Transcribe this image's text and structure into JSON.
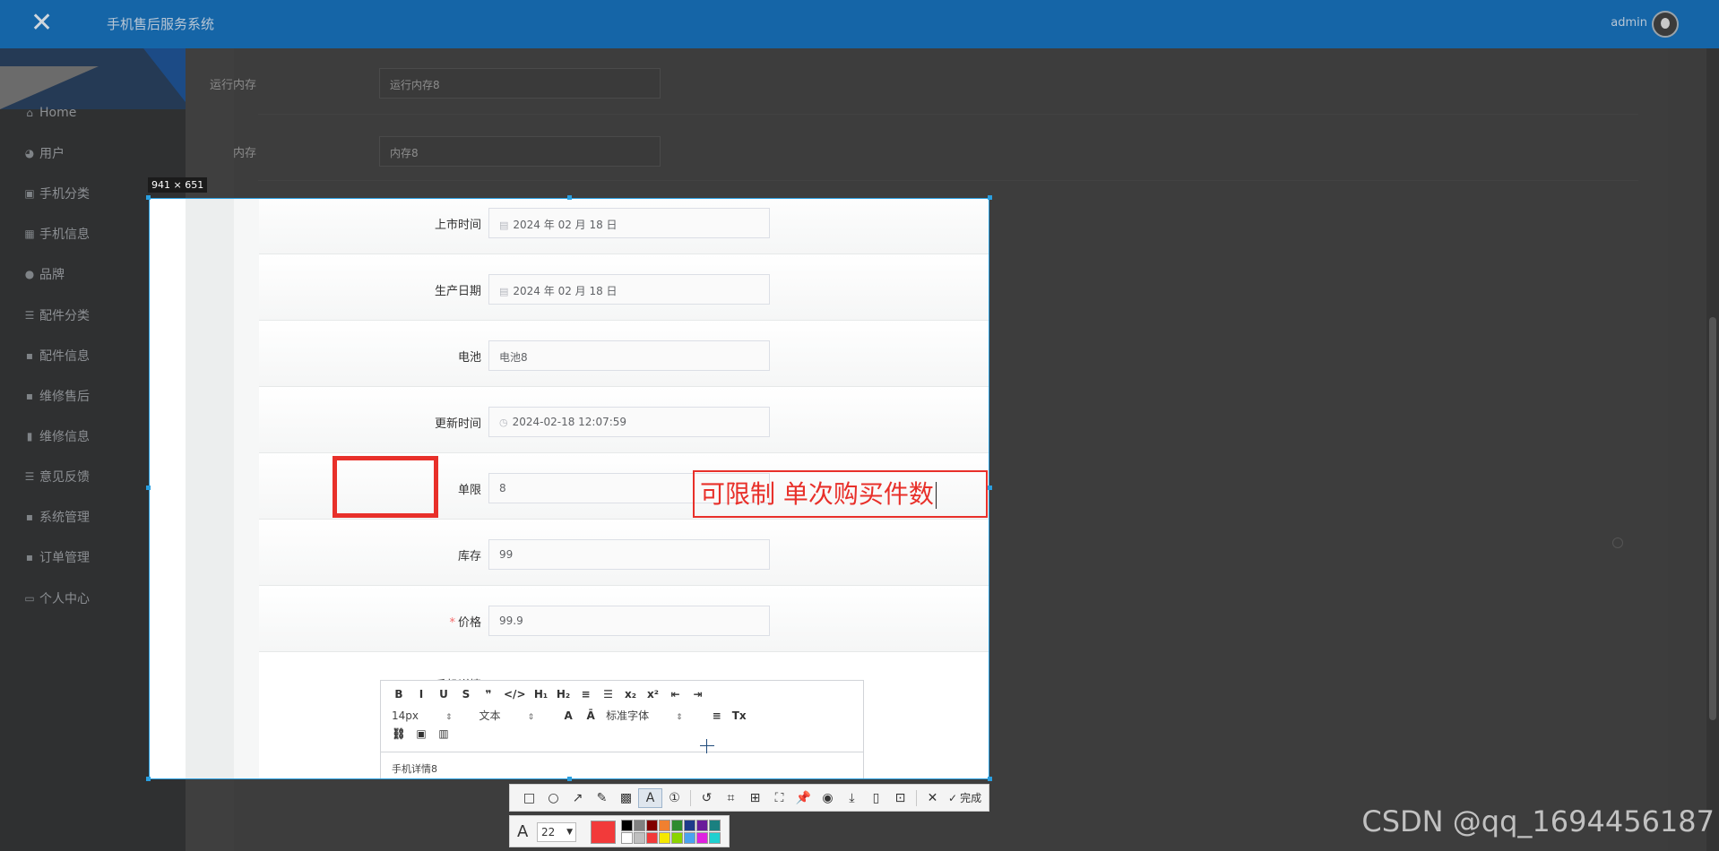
{
  "app": {
    "title": "手机售后服务系统",
    "user": "admin",
    "close_glyph": "✕"
  },
  "sidebar": {
    "items": [
      {
        "label": "Home",
        "icon": "home-icon",
        "glyph": "⌂",
        "chevron": false
      },
      {
        "label": "用户",
        "icon": "user-icon",
        "glyph": "◕",
        "chevron": false
      },
      {
        "label": "手机分类",
        "icon": "category-icon",
        "glyph": "▣",
        "chevron": false
      },
      {
        "label": "手机信息",
        "icon": "grid-icon",
        "glyph": "▦",
        "chevron": false
      },
      {
        "label": "品牌",
        "icon": "person-icon",
        "glyph": "●",
        "chevron": false
      },
      {
        "label": "配件分类",
        "icon": "list-icon",
        "glyph": "☰",
        "chevron": false
      },
      {
        "label": "配件信息",
        "icon": "tiles-icon",
        "glyph": "▪",
        "chevron": false
      },
      {
        "label": "维修售后",
        "icon": "tiles-icon",
        "glyph": "▪",
        "chevron": false
      },
      {
        "label": "维修信息",
        "icon": "bar-chart-icon",
        "glyph": "▮",
        "chevron": false
      },
      {
        "label": "意见反馈",
        "icon": "list-icon",
        "glyph": "☰",
        "chevron": false
      },
      {
        "label": "系统管理",
        "icon": "tiles-icon",
        "glyph": "▪",
        "chevron": true
      },
      {
        "label": "订单管理",
        "icon": "tiles-icon",
        "glyph": "▪",
        "chevron": true
      },
      {
        "label": "个人中心",
        "icon": "window-icon",
        "glyph": "▭",
        "chevron": true
      }
    ]
  },
  "background_form": {
    "fields": [
      {
        "label": "运行内存",
        "value": "运行内存8"
      },
      {
        "label": "内存",
        "value": "内存8"
      }
    ]
  },
  "form": {
    "fields": [
      {
        "label": "上市时间",
        "value": "2024 年 02 月 18 日",
        "icon": "calendar-icon",
        "glyph": "▤",
        "required": false
      },
      {
        "label": "生产日期",
        "value": "2024 年 02 月 18 日",
        "icon": "calendar-icon",
        "glyph": "▤",
        "required": false
      },
      {
        "label": "电池",
        "value": "电池8",
        "icon": "",
        "glyph": "",
        "required": false
      },
      {
        "label": "更新时间",
        "value": "2024-02-18 12:07:59",
        "icon": "clock-icon",
        "glyph": "◷",
        "required": false
      },
      {
        "label": "单限",
        "value": "8",
        "icon": "",
        "glyph": "",
        "required": false
      },
      {
        "label": "库存",
        "value": "99",
        "icon": "",
        "glyph": "",
        "required": false
      },
      {
        "label": "价格",
        "value": "99.9",
        "icon": "",
        "glyph": "",
        "required": true
      }
    ],
    "required_mark": "*",
    "editor": {
      "label": "手机详情",
      "content": "手机详情8",
      "row1": [
        "B",
        "I",
        "U",
        "S",
        "❞",
        "</>",
        "H₁",
        "H₂",
        "≡",
        "☰",
        "x₂",
        "x²",
        "⇤",
        "⇥"
      ],
      "selects": [
        {
          "value": "14px",
          "arrow": "⇕"
        },
        {
          "value": "文本",
          "arrow": "⇕"
        },
        {
          "value": "标准字体",
          "arrow": "⇕"
        }
      ],
      "row2_extra": [
        "A",
        "Ā",
        "≡",
        "Tx"
      ],
      "row3": [
        "⛓",
        "▣",
        "▥"
      ]
    }
  },
  "annotation": {
    "text": "可限制 单次购买件数",
    "dimension_label": "941 × 651",
    "color": "#e8302a"
  },
  "snip_toolbar": {
    "tools": [
      {
        "name": "rectangle-tool-icon",
        "glyph": "□"
      },
      {
        "name": "ellipse-tool-icon",
        "glyph": "○"
      },
      {
        "name": "arrow-tool-icon",
        "glyph": "↗"
      },
      {
        "name": "pen-tool-icon",
        "glyph": "✎"
      },
      {
        "name": "mosaic-tool-icon",
        "glyph": "▩"
      },
      {
        "name": "text-tool-icon",
        "glyph": "A",
        "active": true
      },
      {
        "name": "number-tool-icon",
        "glyph": "①"
      },
      {
        "name": "undo-icon",
        "glyph": "↺"
      },
      {
        "name": "ocr-icon",
        "glyph": "⌗"
      },
      {
        "name": "translate-icon",
        "glyph": "⊞"
      },
      {
        "name": "scan-icon",
        "glyph": "⛶"
      },
      {
        "name": "pin-icon",
        "glyph": "📌"
      },
      {
        "name": "record-icon",
        "glyph": "◉"
      },
      {
        "name": "download-icon",
        "glyph": "⤓"
      },
      {
        "name": "phone-icon",
        "glyph": "▯"
      },
      {
        "name": "bookmark-icon",
        "glyph": "⊡"
      }
    ],
    "cancel_glyph": "✕",
    "done_label": "完成",
    "done_glyph": "✓"
  },
  "font_settings": {
    "size": "22",
    "current_color": "#f23a3a",
    "palette": [
      "#000000",
      "#808080",
      "#800000",
      "#f08030",
      "#2e8b2e",
      "#1e3a8a",
      "#6a1b9a",
      "#1a8080",
      "#ffffff",
      "#c0c0c0",
      "#f23a3a",
      "#f5e800",
      "#8bd400",
      "#4aa3f0",
      "#e020e0",
      "#20d0d0"
    ]
  },
  "watermark": "CSDN @qq_1694456187"
}
